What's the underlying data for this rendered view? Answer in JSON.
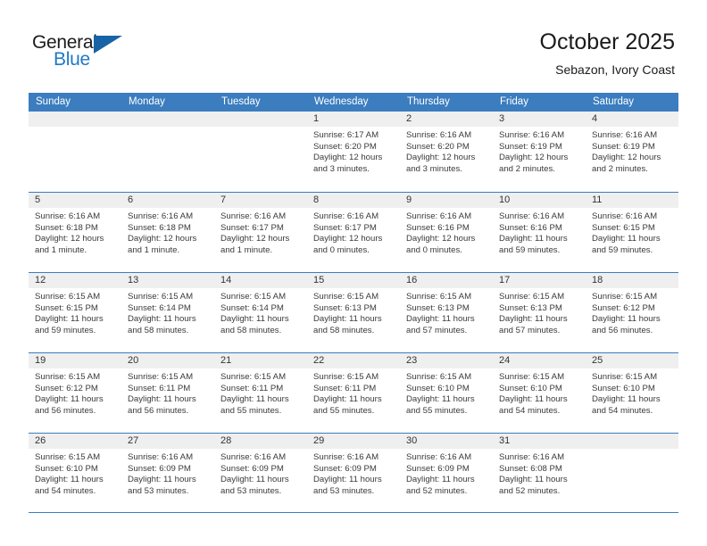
{
  "brand": {
    "name_top": "General",
    "name_bottom": "Blue",
    "accent_color": "#1f7ac4",
    "triangle_color": "#1763a6"
  },
  "header": {
    "title": "October 2025",
    "subtitle": "Sebazon, Ivory Coast"
  },
  "calendar": {
    "header_bg": "#3b7dbf",
    "day_band_bg": "#efefef",
    "weekdays": [
      "Sunday",
      "Monday",
      "Tuesday",
      "Wednesday",
      "Thursday",
      "Friday",
      "Saturday"
    ],
    "weeks": [
      [
        {
          "day": "",
          "empty": true
        },
        {
          "day": "",
          "empty": true
        },
        {
          "day": "",
          "empty": true
        },
        {
          "day": "1",
          "sunrise": "Sunrise: 6:17 AM",
          "sunset": "Sunset: 6:20 PM",
          "daylight_line1": "Daylight: 12 hours",
          "daylight_line2": "and 3 minutes."
        },
        {
          "day": "2",
          "sunrise": "Sunrise: 6:16 AM",
          "sunset": "Sunset: 6:20 PM",
          "daylight_line1": "Daylight: 12 hours",
          "daylight_line2": "and 3 minutes."
        },
        {
          "day": "3",
          "sunrise": "Sunrise: 6:16 AM",
          "sunset": "Sunset: 6:19 PM",
          "daylight_line1": "Daylight: 12 hours",
          "daylight_line2": "and 2 minutes."
        },
        {
          "day": "4",
          "sunrise": "Sunrise: 6:16 AM",
          "sunset": "Sunset: 6:19 PM",
          "daylight_line1": "Daylight: 12 hours",
          "daylight_line2": "and 2 minutes."
        }
      ],
      [
        {
          "day": "5",
          "sunrise": "Sunrise: 6:16 AM",
          "sunset": "Sunset: 6:18 PM",
          "daylight_line1": "Daylight: 12 hours",
          "daylight_line2": "and 1 minute."
        },
        {
          "day": "6",
          "sunrise": "Sunrise: 6:16 AM",
          "sunset": "Sunset: 6:18 PM",
          "daylight_line1": "Daylight: 12 hours",
          "daylight_line2": "and 1 minute."
        },
        {
          "day": "7",
          "sunrise": "Sunrise: 6:16 AM",
          "sunset": "Sunset: 6:17 PM",
          "daylight_line1": "Daylight: 12 hours",
          "daylight_line2": "and 1 minute."
        },
        {
          "day": "8",
          "sunrise": "Sunrise: 6:16 AM",
          "sunset": "Sunset: 6:17 PM",
          "daylight_line1": "Daylight: 12 hours",
          "daylight_line2": "and 0 minutes."
        },
        {
          "day": "9",
          "sunrise": "Sunrise: 6:16 AM",
          "sunset": "Sunset: 6:16 PM",
          "daylight_line1": "Daylight: 12 hours",
          "daylight_line2": "and 0 minutes."
        },
        {
          "day": "10",
          "sunrise": "Sunrise: 6:16 AM",
          "sunset": "Sunset: 6:16 PM",
          "daylight_line1": "Daylight: 11 hours",
          "daylight_line2": "and 59 minutes."
        },
        {
          "day": "11",
          "sunrise": "Sunrise: 6:16 AM",
          "sunset": "Sunset: 6:15 PM",
          "daylight_line1": "Daylight: 11 hours",
          "daylight_line2": "and 59 minutes."
        }
      ],
      [
        {
          "day": "12",
          "sunrise": "Sunrise: 6:15 AM",
          "sunset": "Sunset: 6:15 PM",
          "daylight_line1": "Daylight: 11 hours",
          "daylight_line2": "and 59 minutes."
        },
        {
          "day": "13",
          "sunrise": "Sunrise: 6:15 AM",
          "sunset": "Sunset: 6:14 PM",
          "daylight_line1": "Daylight: 11 hours",
          "daylight_line2": "and 58 minutes."
        },
        {
          "day": "14",
          "sunrise": "Sunrise: 6:15 AM",
          "sunset": "Sunset: 6:14 PM",
          "daylight_line1": "Daylight: 11 hours",
          "daylight_line2": "and 58 minutes."
        },
        {
          "day": "15",
          "sunrise": "Sunrise: 6:15 AM",
          "sunset": "Sunset: 6:13 PM",
          "daylight_line1": "Daylight: 11 hours",
          "daylight_line2": "and 58 minutes."
        },
        {
          "day": "16",
          "sunrise": "Sunrise: 6:15 AM",
          "sunset": "Sunset: 6:13 PM",
          "daylight_line1": "Daylight: 11 hours",
          "daylight_line2": "and 57 minutes."
        },
        {
          "day": "17",
          "sunrise": "Sunrise: 6:15 AM",
          "sunset": "Sunset: 6:13 PM",
          "daylight_line1": "Daylight: 11 hours",
          "daylight_line2": "and 57 minutes."
        },
        {
          "day": "18",
          "sunrise": "Sunrise: 6:15 AM",
          "sunset": "Sunset: 6:12 PM",
          "daylight_line1": "Daylight: 11 hours",
          "daylight_line2": "and 56 minutes."
        }
      ],
      [
        {
          "day": "19",
          "sunrise": "Sunrise: 6:15 AM",
          "sunset": "Sunset: 6:12 PM",
          "daylight_line1": "Daylight: 11 hours",
          "daylight_line2": "and 56 minutes."
        },
        {
          "day": "20",
          "sunrise": "Sunrise: 6:15 AM",
          "sunset": "Sunset: 6:11 PM",
          "daylight_line1": "Daylight: 11 hours",
          "daylight_line2": "and 56 minutes."
        },
        {
          "day": "21",
          "sunrise": "Sunrise: 6:15 AM",
          "sunset": "Sunset: 6:11 PM",
          "daylight_line1": "Daylight: 11 hours",
          "daylight_line2": "and 55 minutes."
        },
        {
          "day": "22",
          "sunrise": "Sunrise: 6:15 AM",
          "sunset": "Sunset: 6:11 PM",
          "daylight_line1": "Daylight: 11 hours",
          "daylight_line2": "and 55 minutes."
        },
        {
          "day": "23",
          "sunrise": "Sunrise: 6:15 AM",
          "sunset": "Sunset: 6:10 PM",
          "daylight_line1": "Daylight: 11 hours",
          "daylight_line2": "and 55 minutes."
        },
        {
          "day": "24",
          "sunrise": "Sunrise: 6:15 AM",
          "sunset": "Sunset: 6:10 PM",
          "daylight_line1": "Daylight: 11 hours",
          "daylight_line2": "and 54 minutes."
        },
        {
          "day": "25",
          "sunrise": "Sunrise: 6:15 AM",
          "sunset": "Sunset: 6:10 PM",
          "daylight_line1": "Daylight: 11 hours",
          "daylight_line2": "and 54 minutes."
        }
      ],
      [
        {
          "day": "26",
          "sunrise": "Sunrise: 6:15 AM",
          "sunset": "Sunset: 6:10 PM",
          "daylight_line1": "Daylight: 11 hours",
          "daylight_line2": "and 54 minutes."
        },
        {
          "day": "27",
          "sunrise": "Sunrise: 6:16 AM",
          "sunset": "Sunset: 6:09 PM",
          "daylight_line1": "Daylight: 11 hours",
          "daylight_line2": "and 53 minutes."
        },
        {
          "day": "28",
          "sunrise": "Sunrise: 6:16 AM",
          "sunset": "Sunset: 6:09 PM",
          "daylight_line1": "Daylight: 11 hours",
          "daylight_line2": "and 53 minutes."
        },
        {
          "day": "29",
          "sunrise": "Sunrise: 6:16 AM",
          "sunset": "Sunset: 6:09 PM",
          "daylight_line1": "Daylight: 11 hours",
          "daylight_line2": "and 53 minutes."
        },
        {
          "day": "30",
          "sunrise": "Sunrise: 6:16 AM",
          "sunset": "Sunset: 6:09 PM",
          "daylight_line1": "Daylight: 11 hours",
          "daylight_line2": "and 52 minutes."
        },
        {
          "day": "31",
          "sunrise": "Sunrise: 6:16 AM",
          "sunset": "Sunset: 6:08 PM",
          "daylight_line1": "Daylight: 11 hours",
          "daylight_line2": "and 52 minutes."
        },
        {
          "day": "",
          "empty": true
        }
      ]
    ]
  }
}
